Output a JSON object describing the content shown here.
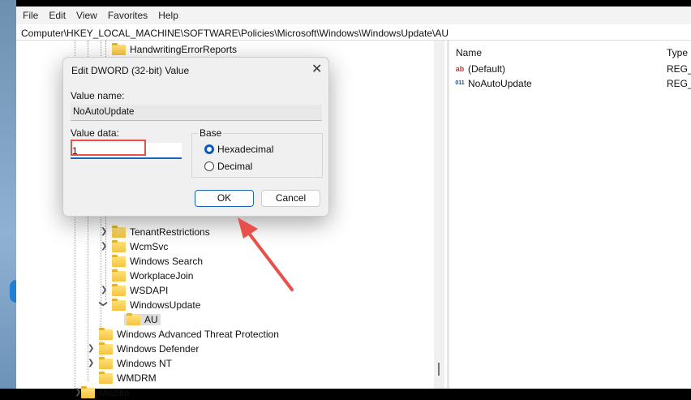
{
  "menu": [
    "File",
    "Edit",
    "View",
    "Favorites",
    "Help"
  ],
  "address": "Computer\\HKEY_LOCAL_MACHINE\\SOFTWARE\\Policies\\Microsoft\\Windows\\WindowsUpdate\\AU",
  "tree": [
    "HandwritingErrorReports",
    "TenantRestrictions",
    "WcmSvc",
    "Windows Search",
    "WorkplaceJoin",
    "WSDAPI",
    "WindowsUpdate",
    "AU",
    "Windows Advanced Threat Protection",
    "Windows Defender",
    "Windows NT",
    "WMDRM",
    "Mozilla"
  ],
  "list": {
    "headers": {
      "name": "Name",
      "type": "Type"
    },
    "rows": [
      {
        "name": "(Default)",
        "type": "REG_SZ",
        "icon": "ab"
      },
      {
        "name": "NoAutoUpdate",
        "type": "REG_DWORD",
        "icon": "011"
      }
    ]
  },
  "dialog": {
    "title": "Edit DWORD (32-bit) Value",
    "value_name_label": "Value name:",
    "value_name": "NoAutoUpdate",
    "value_data_label": "Value data:",
    "value_data": "1",
    "base_label": "Base",
    "hex": "Hexadecimal",
    "dec": "Decimal",
    "selected_base": "Hexadecimal",
    "ok": "OK",
    "cancel": "Cancel"
  },
  "colors": {
    "annotation": "#e8514a",
    "accent": "#0b5cb8"
  }
}
